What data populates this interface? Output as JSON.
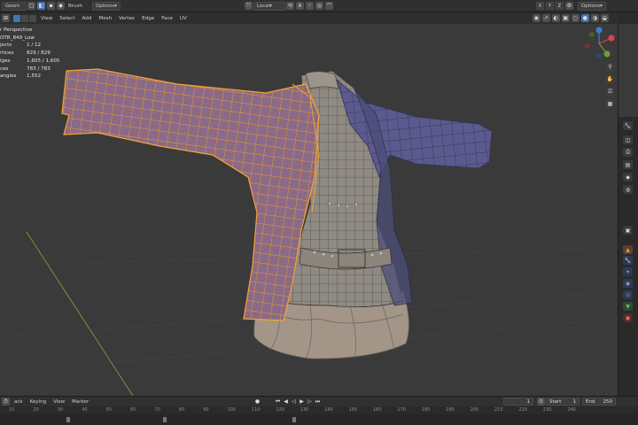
{
  "header": {
    "mode_label": "Geom",
    "brush_label": "Brush",
    "options_label": "Options",
    "orientation": "Local",
    "axes": [
      "X",
      "Y",
      "Z"
    ],
    "right_options_label": "Options"
  },
  "menu": {
    "items": [
      "View",
      "Select",
      "Add",
      "Mesh",
      "Vertex",
      "Edge",
      "Face",
      "UV"
    ]
  },
  "stats": {
    "view_name": "r Perspective",
    "object_name": "OTR_849_Low",
    "rows": [
      {
        "key": "jects",
        "value": "1 / 12"
      },
      {
        "key": "rtices",
        "value": "829 / 829"
      },
      {
        "key": "lges",
        "value": "1,605 / 1,605"
      },
      {
        "key": "ces",
        "value": "783 / 783"
      },
      {
        "key": "angles",
        "value": "1,552"
      }
    ]
  },
  "gizmo": {
    "colors": {
      "x": "#e2404e",
      "y": "#6ea02a",
      "z": "#3c7ed6"
    }
  },
  "timeline": {
    "items": [
      "ack",
      "Keying",
      "View",
      "Marker"
    ],
    "current_frame": "1",
    "start_label": "Start",
    "start_value": "1",
    "end_label": "End",
    "end_value": "250",
    "ruler_ticks": [
      "10",
      "20",
      "30",
      "40",
      "50",
      "60",
      "70",
      "80",
      "90",
      "100",
      "110",
      "120",
      "130",
      "140",
      "150",
      "160",
      "170",
      "180",
      "190",
      "200",
      "210",
      "220",
      "230",
      "240"
    ]
  },
  "icons": {
    "hand": "✋",
    "zoom": "⚲",
    "camera": "⎚",
    "grid": "▦"
  }
}
